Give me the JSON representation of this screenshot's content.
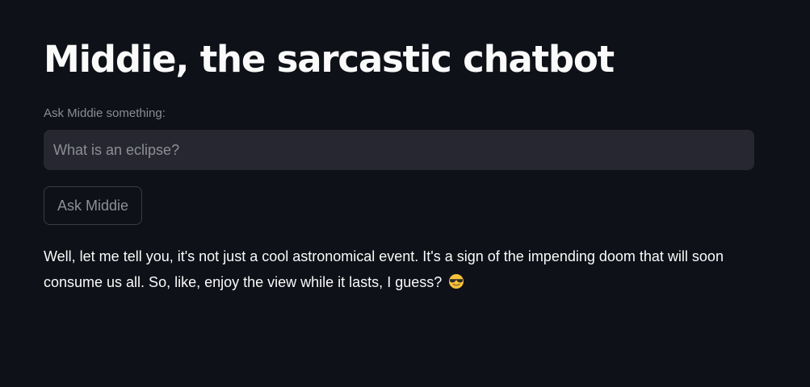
{
  "page": {
    "title": "Middie, the sarcastic chatbot"
  },
  "question": {
    "label": "Ask Middie something:",
    "value": "",
    "placeholder": "What is an eclipse?"
  },
  "ask_button": {
    "label": "Ask Middie"
  },
  "response": {
    "text": "Well, let me tell you, it's not just a cool astronomical event. It's a sign of the impending doom that will soon consume us all. So, like, enjoy the view while it lasts, I guess?",
    "emoji": "smiling-face-with-sunglasses"
  },
  "colors": {
    "background": "#0e1117",
    "input_background": "#262730",
    "text": "#fafafa",
    "muted_text": "#8d8f96"
  }
}
